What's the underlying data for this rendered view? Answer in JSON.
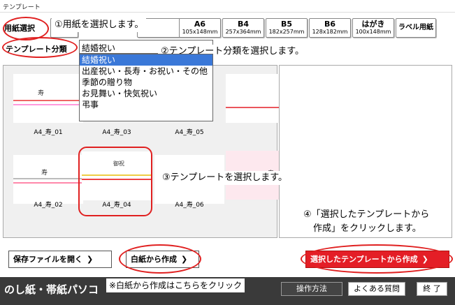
{
  "window": {
    "title": "テンプレート"
  },
  "paper": {
    "select_label": "用紙選択",
    "buttons": [
      {
        "size": "A6",
        "dims": "105x148mm"
      },
      {
        "size": "B4",
        "dims": "257x364mm"
      },
      {
        "size": "B5",
        "dims": "182x257mm"
      },
      {
        "size": "B6",
        "dims": "128x182mm"
      },
      {
        "size": "はがき",
        "dims": "100x148mm"
      }
    ],
    "label_paper": "ラベル用紙"
  },
  "category": {
    "label": "テンプレート分類",
    "selected": "結婚祝い",
    "options": [
      "結婚祝い",
      "出産祝い・長寿・お祝い・その他",
      "季節の贈り物",
      "お見舞い・快気祝い",
      "弔事"
    ]
  },
  "thumbnails": [
    {
      "label": "A4_寿_03"
    },
    {
      "label": "A4_寿_05"
    },
    {
      "label": "A4_寿_02"
    },
    {
      "label": "A4_寿_04"
    },
    {
      "label": "A4_寿_06"
    }
  ],
  "callouts": {
    "step1": "①用紙を選択します。",
    "step2": "②テンプレート分類を選択します。",
    "step3": "③テンプレートを選択します。",
    "step4_line1": "④「選択したテンプレートから",
    "step4_line2": "作成」をクリックします。",
    "note": "※白紙から作成はこちらをクリック"
  },
  "actions": {
    "open_file": "保存ファイルを開く",
    "blank_create": "白紙から作成",
    "template_create": "選択したテンプレートから作成"
  },
  "footer": {
    "brand": "のし紙・帯紙パソコ",
    "how_to": "操作方法",
    "faq": "よくある質問",
    "exit": "終 了"
  },
  "colors": {
    "accent_red": "#e41e26",
    "footer_bg": "#3a3a3a",
    "selection_blue": "#3a78d8"
  }
}
